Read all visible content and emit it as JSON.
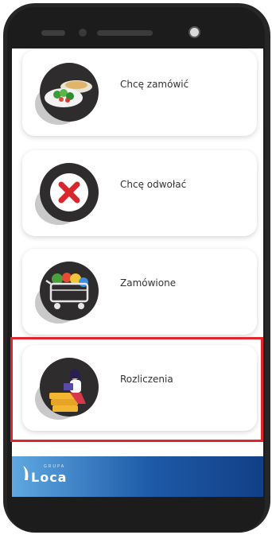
{
  "menu": {
    "items": [
      {
        "label": "Chcę zamówić",
        "icon": "food-plate-icon"
      },
      {
        "label": "Chcę odwołać",
        "icon": "cancel-x-icon"
      },
      {
        "label": "Zamówione",
        "icon": "shopping-cart-icon"
      },
      {
        "label": "Rozliczenia",
        "icon": "person-coins-icon"
      }
    ]
  },
  "footer": {
    "logo_text": "Loca",
    "logo_small": "GRUPA"
  },
  "colors": {
    "highlight": "#e0262c",
    "footer_start": "#5fa8e0",
    "footer_end": "#123f85",
    "cancel_red": "#d8262c"
  }
}
